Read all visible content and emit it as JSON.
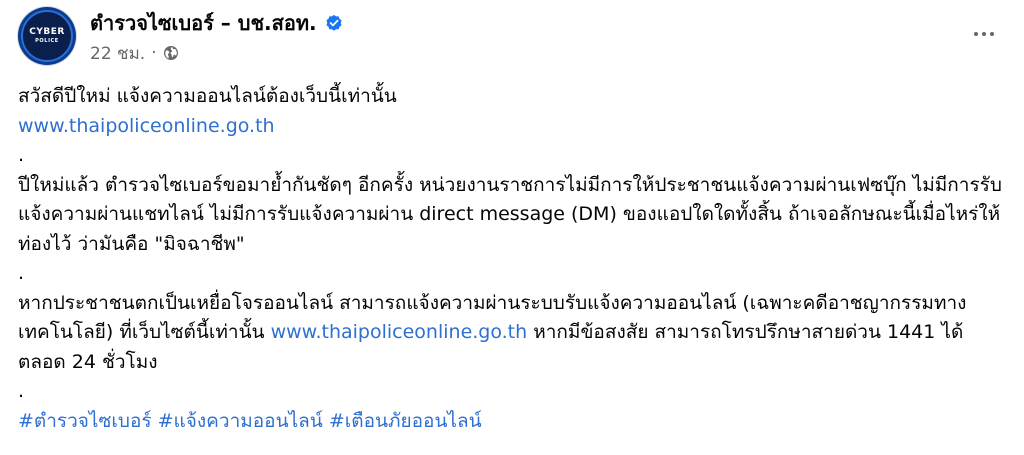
{
  "post": {
    "avatar": {
      "icon": "cyber-police-logo",
      "line1": "CYBER",
      "line2": "POLICE"
    },
    "page_name": "ตำรวจไซเบอร์ – บช.สอท.",
    "verified_icon": "verified-badge-icon",
    "time": "22 ชม.",
    "separator": "·",
    "audience_icon": "globe-icon",
    "more_icon": "more-options-icon",
    "content": {
      "headline": "สวัสดีปีใหม่ แจ้งความออนไลน์ต้องเว็บนี้เท่านั้น",
      "link1": "www.thaipoliceonline.go.th",
      "dot1": ".",
      "para1": "ปีใหม่แล้ว ตำรวจไซเบอร์ขอมาย้ำกันชัดๆ อีกครั้ง หน่วยงานราชการไม่มีการให้ประชาชนแจ้งความผ่านเฟซบุ๊ก ไม่มีการรับแจ้งความผ่านแชทไลน์ ไม่มีการรับแจ้งความผ่าน direct message (DM) ของแอปใดใดทั้งสิ้น ถ้าเจอลักษณะนี้เมื่อไหร่ให้ท่องไว้ ว่ามันคือ \"มิจฉาชีพ\"",
      "dot2": ".",
      "para2_before": "หากประชาชนตกเป็นเหยื่อโจรออนไลน์ สามารถแจ้งความผ่านระบบรับแจ้งความออนไลน์ (เฉพาะคดีอาชญากรรมทางเทคโนโลยี) ที่เว็บไซต์นี้เท่านั้น ",
      "para2_link": "www.thaipoliceonline.go.th",
      "para2_after": " หากมีข้อสงสัย สามารถโทรปรึกษาสายด่วน 1441 ได้ตลอด 24 ชั่วโมง",
      "dot3": ".",
      "hashtags": [
        "#ตำรวจไซเบอร์",
        "#แจ้งความออนไลน์",
        "#เตือนภัยออนไลน์"
      ]
    }
  },
  "colors": {
    "link": "#2f6fcf",
    "text": "#050505",
    "meta": "#65676b",
    "verified": "#1877f2"
  }
}
